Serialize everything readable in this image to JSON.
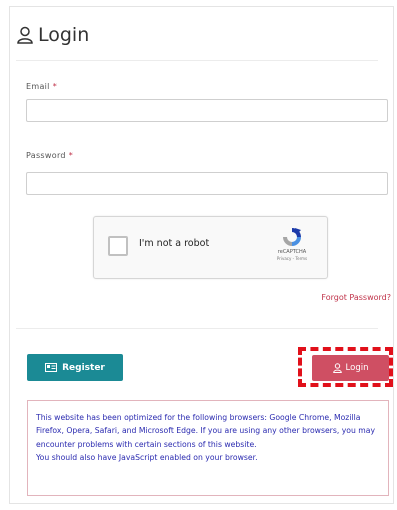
{
  "header": {
    "title": "Login",
    "icon": "user-icon"
  },
  "form": {
    "email_label": "Email",
    "email_value": "",
    "password_label": "Password",
    "password_value": "",
    "required_mark": "*"
  },
  "captcha": {
    "text": "I'm not a robot",
    "brand": "reCAPTCHA",
    "privacy": "Privacy - Terms"
  },
  "links": {
    "forgot_password": "Forgot Password?"
  },
  "buttons": {
    "register_label": "Register",
    "login_label": "Login"
  },
  "notice": {
    "line1": "This website has been optimized for the following browsers: Google Chrome, Mozilla Firefox, Opera, Safari, and Microsoft Edge. If you are using any other browsers, you may encounter problems with certain sections of this website.",
    "line2": "You should also have JavaScript enabled on your browser."
  },
  "colors": {
    "accent_register": "#1b8a95",
    "accent_login": "#cf4f63",
    "highlight": "#e1101a",
    "notice_text": "#2b2bb0"
  }
}
